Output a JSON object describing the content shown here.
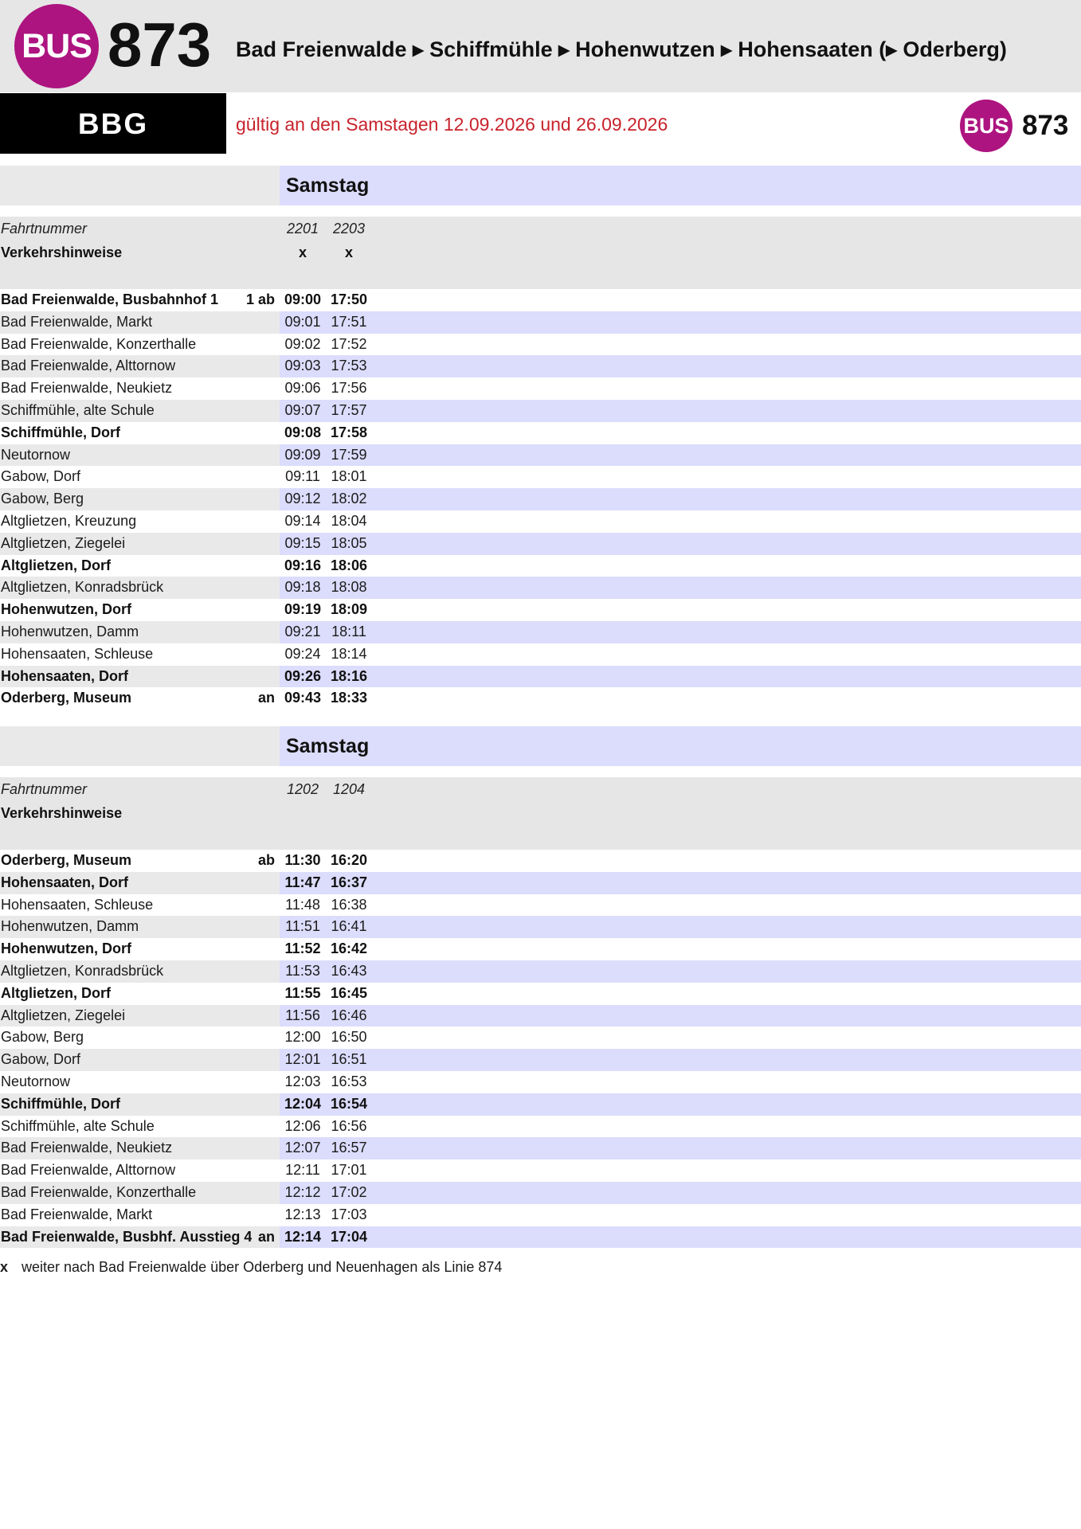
{
  "header": {
    "logo_label": "BUS",
    "line_number": "873",
    "route_title": "Bad Freienwalde ▸ Schiffmühle ▸ Hohenwutzen ▸ Hohensaaten (▸ Oderberg)",
    "operator": "BBG",
    "validity": "gültig an den Samstagen 12.09.2026 und 26.09.2026",
    "badge_label": "BUS",
    "badge_line": "873"
  },
  "colors": {
    "brand": "#ad1480",
    "validity_text": "#c8232c",
    "time_stripe": "#dcdcfc",
    "name_stripe": "#e9e9e9",
    "header_band": "#e6e6e6"
  },
  "labels": {
    "trip_number": "Fahrtnummer",
    "notes": "Verkehrshinweise"
  },
  "sections": [
    {
      "day": "Samstag",
      "trips": [
        {
          "number": "2201",
          "note": "x"
        },
        {
          "number": "2203",
          "note": "x"
        }
      ],
      "stops": [
        {
          "name": "Bad Freienwalde, Busbahnhof 1",
          "marker": "1 ab",
          "bold": true,
          "times": [
            "09:00",
            "17:50"
          ]
        },
        {
          "name": "Bad Freienwalde, Markt",
          "times": [
            "09:01",
            "17:51"
          ]
        },
        {
          "name": "Bad Freienwalde, Konzerthalle",
          "times": [
            "09:02",
            "17:52"
          ]
        },
        {
          "name": "Bad Freienwalde, Alttornow",
          "times": [
            "09:03",
            "17:53"
          ]
        },
        {
          "name": "Bad Freienwalde, Neukietz",
          "times": [
            "09:06",
            "17:56"
          ]
        },
        {
          "name": "Schiffmühle, alte Schule",
          "times": [
            "09:07",
            "17:57"
          ]
        },
        {
          "name": "Schiffmühle, Dorf",
          "bold": true,
          "times": [
            "09:08",
            "17:58"
          ]
        },
        {
          "name": "Neutornow",
          "times": [
            "09:09",
            "17:59"
          ]
        },
        {
          "name": "Gabow, Dorf",
          "times": [
            "09:11",
            "18:01"
          ]
        },
        {
          "name": "Gabow, Berg",
          "times": [
            "09:12",
            "18:02"
          ]
        },
        {
          "name": "Altglietzen, Kreuzung",
          "times": [
            "09:14",
            "18:04"
          ]
        },
        {
          "name": "Altglietzen, Ziegelei",
          "times": [
            "09:15",
            "18:05"
          ]
        },
        {
          "name": "Altglietzen, Dorf",
          "bold": true,
          "times": [
            "09:16",
            "18:06"
          ]
        },
        {
          "name": "Altglietzen, Konradsbrück",
          "times": [
            "09:18",
            "18:08"
          ]
        },
        {
          "name": "Hohenwutzen, Dorf",
          "bold": true,
          "times": [
            "09:19",
            "18:09"
          ]
        },
        {
          "name": "Hohenwutzen, Damm",
          "times": [
            "09:21",
            "18:11"
          ]
        },
        {
          "name": "Hohensaaten, Schleuse",
          "times": [
            "09:24",
            "18:14"
          ]
        },
        {
          "name": "Hohensaaten, Dorf",
          "bold": true,
          "times": [
            "09:26",
            "18:16"
          ]
        },
        {
          "name": "Oderberg, Museum",
          "marker": "an",
          "bold": true,
          "times": [
            "09:43",
            "18:33"
          ]
        }
      ]
    },
    {
      "day": "Samstag",
      "trips": [
        {
          "number": "1202"
        },
        {
          "number": "1204"
        }
      ],
      "stops": [
        {
          "name": "Oderberg, Museum",
          "marker": "ab",
          "bold": true,
          "times": [
            "11:30",
            "16:20"
          ]
        },
        {
          "name": "Hohensaaten, Dorf",
          "bold": true,
          "times": [
            "11:47",
            "16:37"
          ]
        },
        {
          "name": "Hohensaaten, Schleuse",
          "times": [
            "11:48",
            "16:38"
          ]
        },
        {
          "name": "Hohenwutzen, Damm",
          "times": [
            "11:51",
            "16:41"
          ]
        },
        {
          "name": "Hohenwutzen, Dorf",
          "bold": true,
          "times": [
            "11:52",
            "16:42"
          ]
        },
        {
          "name": "Altglietzen, Konradsbrück",
          "times": [
            "11:53",
            "16:43"
          ]
        },
        {
          "name": "Altglietzen, Dorf",
          "bold": true,
          "times": [
            "11:55",
            "16:45"
          ]
        },
        {
          "name": "Altglietzen, Ziegelei",
          "times": [
            "11:56",
            "16:46"
          ]
        },
        {
          "name": "Gabow, Berg",
          "times": [
            "12:00",
            "16:50"
          ]
        },
        {
          "name": "Gabow, Dorf",
          "times": [
            "12:01",
            "16:51"
          ]
        },
        {
          "name": "Neutornow",
          "times": [
            "12:03",
            "16:53"
          ]
        },
        {
          "name": "Schiffmühle, Dorf",
          "bold": true,
          "times": [
            "12:04",
            "16:54"
          ]
        },
        {
          "name": "Schiffmühle, alte Schule",
          "times": [
            "12:06",
            "16:56"
          ]
        },
        {
          "name": "Bad Freienwalde, Neukietz",
          "times": [
            "12:07",
            "16:57"
          ]
        },
        {
          "name": "Bad Freienwalde, Alttornow",
          "times": [
            "12:11",
            "17:01"
          ]
        },
        {
          "name": "Bad Freienwalde, Konzerthalle",
          "times": [
            "12:12",
            "17:02"
          ]
        },
        {
          "name": "Bad Freienwalde, Markt",
          "times": [
            "12:13",
            "17:03"
          ]
        },
        {
          "name": "Bad Freienwalde, Busbhf. Ausstieg 4",
          "marker": "an",
          "bold": true,
          "times": [
            "12:14",
            "17:04"
          ]
        }
      ]
    }
  ],
  "footnote": {
    "symbol": "x",
    "text": "weiter nach Bad Freienwalde über Oderberg und Neuenhagen als Linie 874"
  }
}
